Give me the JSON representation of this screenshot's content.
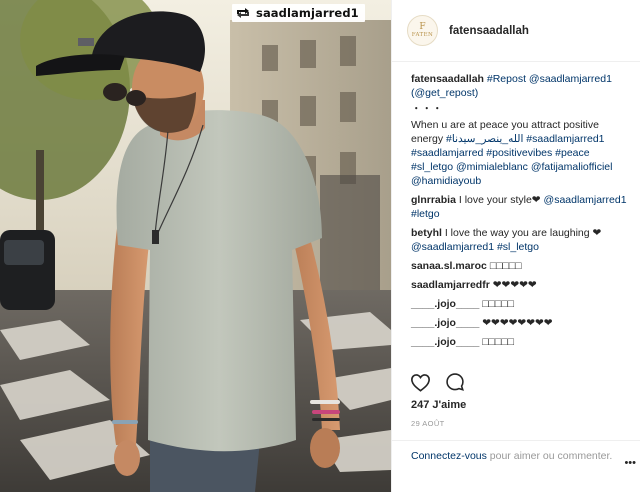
{
  "repost_badge": {
    "handle": "saadlamjarred1"
  },
  "header": {
    "username": "fatensaadallah",
    "avatar_mark": "F",
    "avatar_brand": "FATEN"
  },
  "caption": {
    "username": "fatensaadallah",
    "repost_tag": "#Repost",
    "repost_mention": "@saadlamjarred1",
    "get_repost": "(@get_repost)",
    "dots": "・・・",
    "text": "When u are at peace you attract positive energy",
    "tags_line1": "#الله_ينصر_سيدنا",
    "tags_line1b": "#saadlamjarred1",
    "tags_line2": "#saadlamjarred #positivevibes #peace",
    "tags_line3": "#sl_letgo",
    "mention_mimia": "@mimialeblanc",
    "mention_fati": "@fatijamaliofficiel",
    "mention_hamid": "@hamidiayoub"
  },
  "comments": [
    {
      "user": "glnrrabia",
      "text": "I love your style❤",
      "links": "@saadlamjarred1 #letgo"
    },
    {
      "user": "betyhl",
      "text": "I love the way you are laughing ❤",
      "links": "@saadlamjarred1 #sl_letgo"
    },
    {
      "user": "sanaa.sl.maroc",
      "text": "□□□□□"
    },
    {
      "user": "saadlamjarredfr",
      "text": "❤❤❤❤❤"
    },
    {
      "user": "____.jojo____",
      "text": "□□□□□"
    },
    {
      "user": "____.jojo____",
      "text": "❤❤❤❤❤❤❤❤"
    },
    {
      "user": "____.jojo____",
      "text": "□□□□□"
    }
  ],
  "actions": {
    "like_icon": "heart-icon",
    "comment_icon": "comment-icon"
  },
  "likes": "247 J'aime",
  "date": "29 AOÛT",
  "login": {
    "link": "Connectez-vous",
    "rest": " pour aimer ou commenter."
  },
  "more": "•••"
}
